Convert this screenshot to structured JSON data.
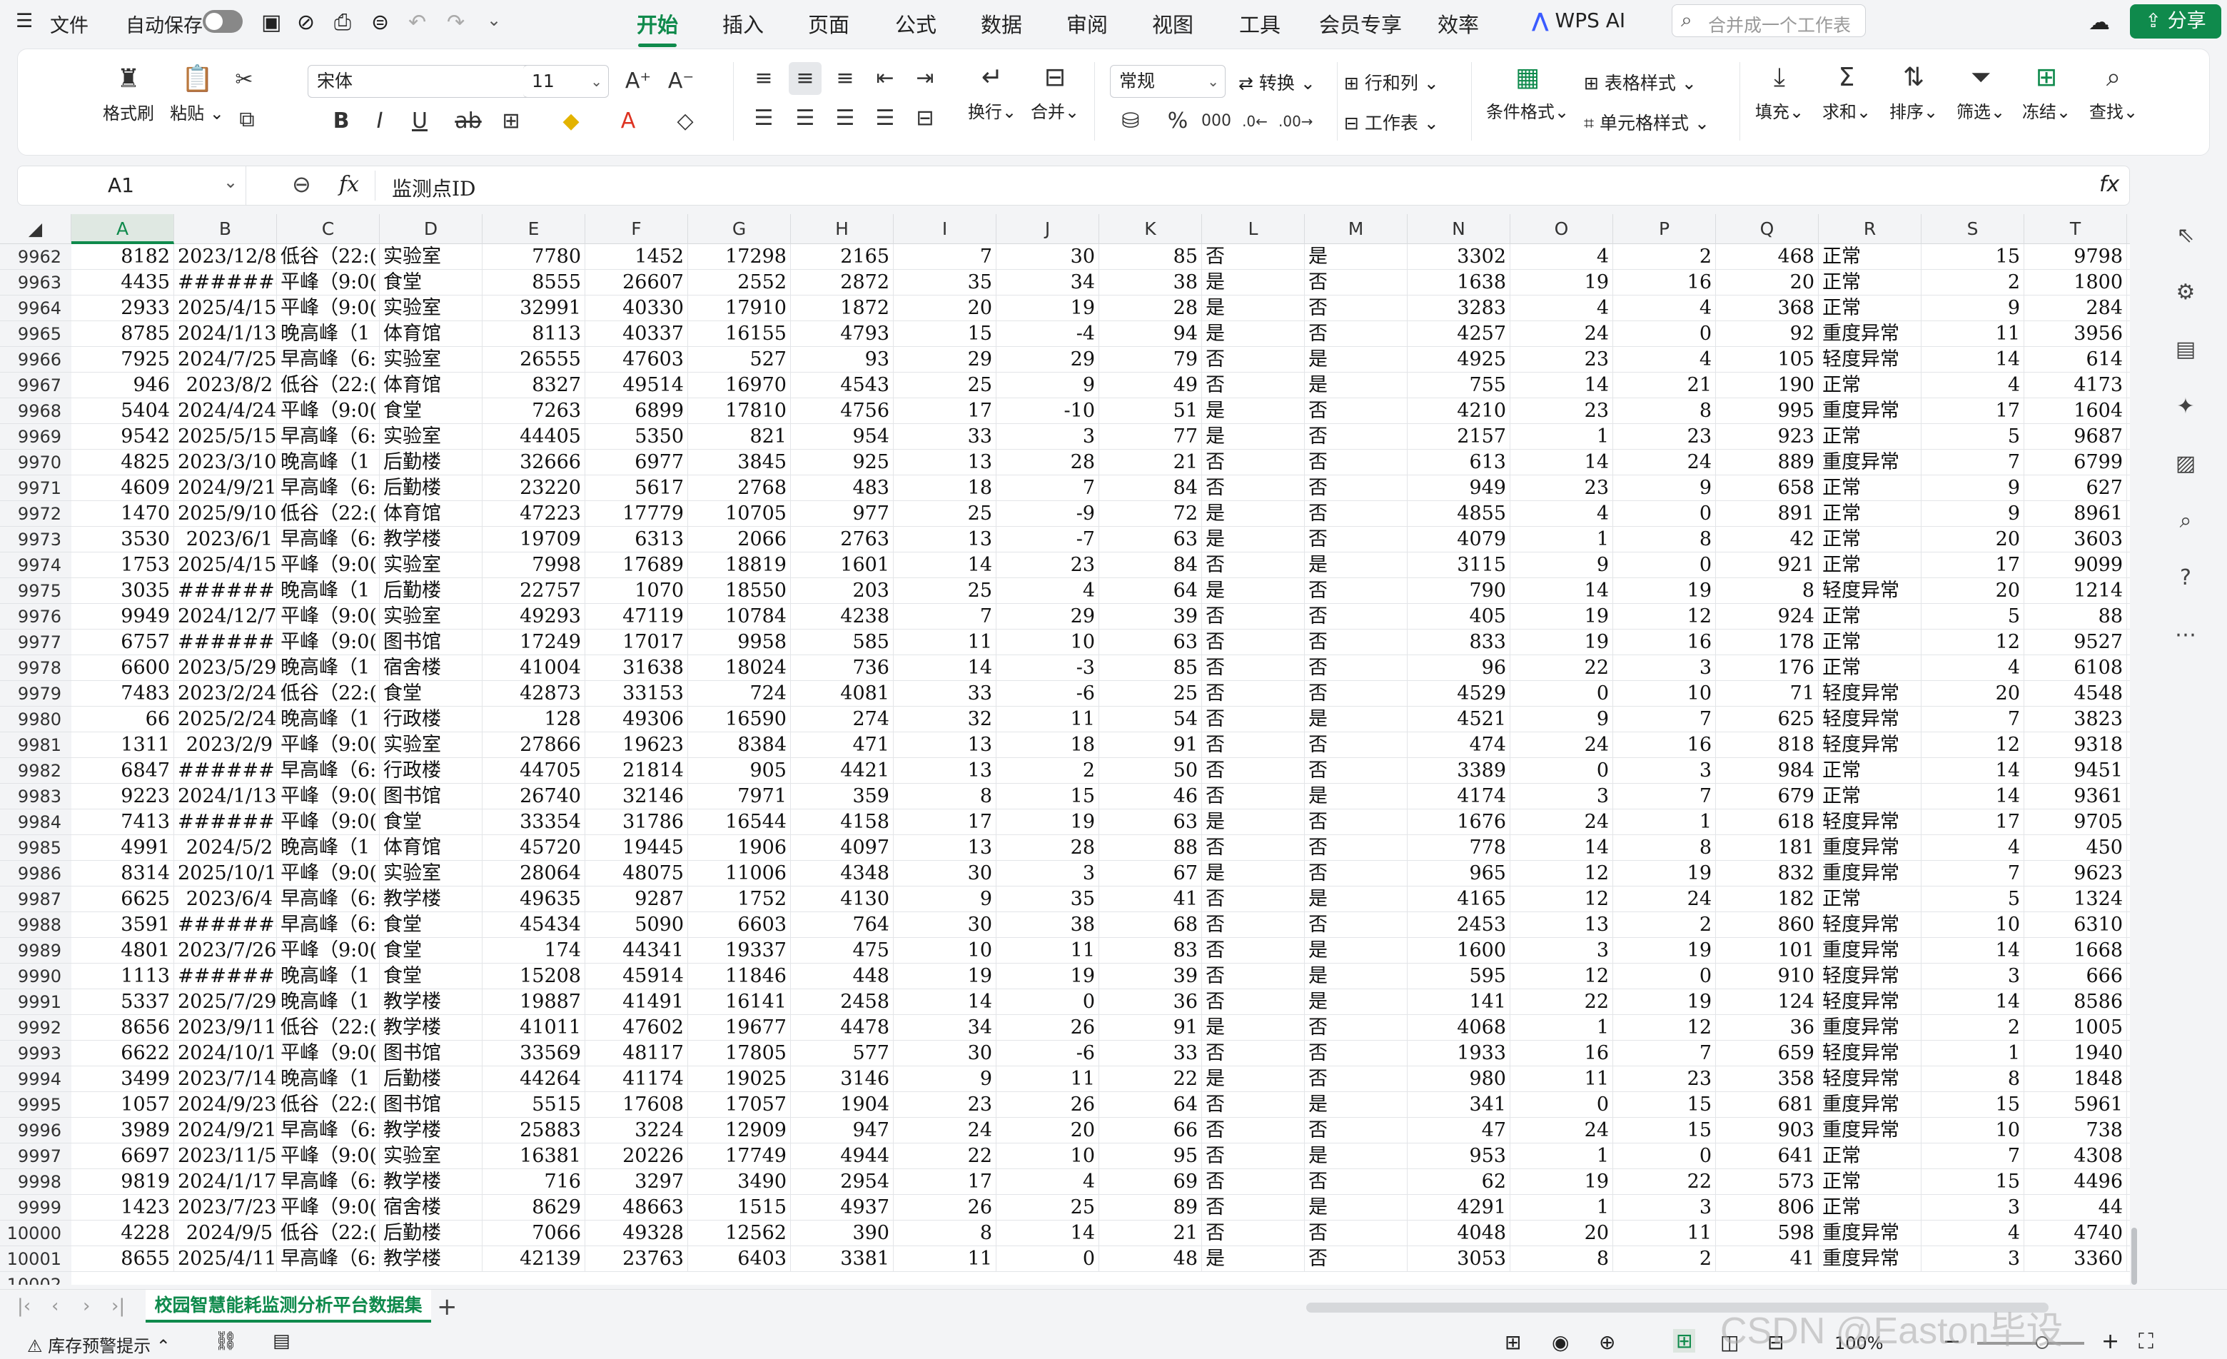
{
  "menubar": {
    "file": "文件",
    "autosave": "自动保存",
    "tabs": [
      "开始",
      "插入",
      "页面",
      "公式",
      "数据",
      "审阅",
      "视图",
      "工具",
      "会员专享",
      "效率"
    ],
    "wps_ai": "WPS AI",
    "search_placeholder": "合并成一个工作表",
    "share": "分享"
  },
  "ribbon": {
    "format_painter": "格式刷",
    "paste": "粘贴",
    "font_name": "宋体",
    "font_size": "11",
    "number_format": "常规",
    "convert": "转换",
    "row_col": "行和列",
    "worksheet": "工作表",
    "wrap": "换行",
    "merge": "合并",
    "cond_format": "条件格式",
    "table_style": "表格样式",
    "cell_style": "单元格样式",
    "fill": "填充",
    "sum": "求和",
    "sort": "排序",
    "filter": "筛选",
    "freeze": "冻结",
    "find": "查找"
  },
  "formula_bar": {
    "cell_ref": "A1",
    "fx": "fx",
    "content": "监测点ID"
  },
  "columns": [
    "A",
    "B",
    "C",
    "D",
    "E",
    "F",
    "G",
    "H",
    "I",
    "J",
    "K",
    "L",
    "M",
    "N",
    "O",
    "P",
    "Q",
    "R",
    "S",
    "T"
  ],
  "rows": [
    {
      "n": "9962",
      "c": [
        "8182",
        "2023/12/8",
        "低谷（22:(",
        "实验室",
        "7780",
        "1452",
        "17298",
        "2165",
        "7",
        "30",
        "85",
        "否",
        "是",
        "3302",
        "4",
        "2",
        "468",
        "正常",
        "15",
        "9798"
      ]
    },
    {
      "n": "9963",
      "c": [
        "4435",
        "########",
        "平峰（9:0(",
        "食堂",
        "8555",
        "26607",
        "2552",
        "2872",
        "35",
        "34",
        "38",
        "是",
        "否",
        "1638",
        "19",
        "16",
        "20",
        "正常",
        "2",
        "1800"
      ]
    },
    {
      "n": "9964",
      "c": [
        "2933",
        "2025/4/15",
        "平峰（9:0(",
        "实验室",
        "32991",
        "40330",
        "17910",
        "1872",
        "20",
        "19",
        "28",
        "是",
        "否",
        "3283",
        "4",
        "4",
        "368",
        "正常",
        "9",
        "284"
      ]
    },
    {
      "n": "9965",
      "c": [
        "8785",
        "2024/1/13",
        "晚高峰（1",
        "体育馆",
        "8113",
        "40337",
        "16155",
        "4793",
        "15",
        "-4",
        "94",
        "是",
        "否",
        "4257",
        "24",
        "0",
        "92",
        "重度异常",
        "11",
        "3956"
      ]
    },
    {
      "n": "9966",
      "c": [
        "7925",
        "2024/7/25",
        "早高峰（6:",
        "实验室",
        "26555",
        "47603",
        "527",
        "93",
        "29",
        "29",
        "79",
        "否",
        "是",
        "4925",
        "23",
        "4",
        "105",
        "轻度异常",
        "14",
        "614"
      ]
    },
    {
      "n": "9967",
      "c": [
        "946",
        "2023/8/2",
        "低谷（22:(",
        "体育馆",
        "8327",
        "49514",
        "16970",
        "4543",
        "25",
        "9",
        "49",
        "否",
        "是",
        "755",
        "14",
        "21",
        "190",
        "正常",
        "4",
        "4173"
      ]
    },
    {
      "n": "9968",
      "c": [
        "5404",
        "2024/4/24",
        "平峰（9:0(",
        "食堂",
        "7263",
        "6899",
        "17810",
        "4756",
        "17",
        "-10",
        "51",
        "是",
        "否",
        "4210",
        "23",
        "8",
        "995",
        "重度异常",
        "17",
        "1604"
      ]
    },
    {
      "n": "9969",
      "c": [
        "9542",
        "2025/5/15",
        "早高峰（6:",
        "实验室",
        "44405",
        "5350",
        "821",
        "954",
        "33",
        "3",
        "77",
        "是",
        "否",
        "2157",
        "1",
        "23",
        "923",
        "正常",
        "5",
        "9687"
      ]
    },
    {
      "n": "9970",
      "c": [
        "4825",
        "2023/3/10",
        "晚高峰（1",
        "后勤楼",
        "32666",
        "6977",
        "3845",
        "925",
        "13",
        "28",
        "21",
        "否",
        "否",
        "613",
        "14",
        "24",
        "889",
        "重度异常",
        "7",
        "6799"
      ]
    },
    {
      "n": "9971",
      "c": [
        "4609",
        "2024/9/21",
        "早高峰（6:",
        "后勤楼",
        "23220",
        "5617",
        "2768",
        "483",
        "18",
        "7",
        "84",
        "否",
        "否",
        "949",
        "23",
        "9",
        "658",
        "正常",
        "9",
        "627"
      ]
    },
    {
      "n": "9972",
      "c": [
        "1470",
        "2025/9/10",
        "低谷（22:(",
        "体育馆",
        "47223",
        "17779",
        "10705",
        "977",
        "25",
        "-9",
        "72",
        "是",
        "否",
        "4855",
        "4",
        "0",
        "891",
        "正常",
        "9",
        "8961"
      ]
    },
    {
      "n": "9973",
      "c": [
        "3530",
        "2023/6/1",
        "早高峰（6:",
        "教学楼",
        "19709",
        "6313",
        "2066",
        "2763",
        "13",
        "-7",
        "63",
        "是",
        "否",
        "4079",
        "1",
        "8",
        "42",
        "正常",
        "20",
        "3603"
      ]
    },
    {
      "n": "9974",
      "c": [
        "1753",
        "2025/4/15",
        "平峰（9:0(",
        "实验室",
        "7998",
        "17689",
        "18819",
        "1601",
        "14",
        "23",
        "84",
        "否",
        "是",
        "3115",
        "9",
        "0",
        "921",
        "正常",
        "17",
        "9099"
      ]
    },
    {
      "n": "9975",
      "c": [
        "3035",
        "########",
        "晚高峰（1",
        "后勤楼",
        "22757",
        "1070",
        "18550",
        "203",
        "25",
        "4",
        "64",
        "是",
        "否",
        "790",
        "14",
        "19",
        "8",
        "轻度异常",
        "20",
        "1214"
      ]
    },
    {
      "n": "9976",
      "c": [
        "9949",
        "2024/12/7",
        "平峰（9:0(",
        "实验室",
        "49293",
        "47119",
        "10784",
        "4238",
        "7",
        "29",
        "39",
        "否",
        "否",
        "405",
        "19",
        "12",
        "924",
        "正常",
        "5",
        "88"
      ]
    },
    {
      "n": "9977",
      "c": [
        "6757",
        "########",
        "平峰（9:0(",
        "图书馆",
        "17249",
        "17017",
        "9958",
        "585",
        "11",
        "10",
        "63",
        "否",
        "否",
        "833",
        "19",
        "16",
        "178",
        "正常",
        "12",
        "9527"
      ]
    },
    {
      "n": "9978",
      "c": [
        "6600",
        "2023/5/29",
        "晚高峰（1",
        "宿舍楼",
        "41004",
        "31638",
        "18024",
        "736",
        "14",
        "-3",
        "85",
        "否",
        "否",
        "96",
        "22",
        "3",
        "176",
        "正常",
        "4",
        "6108"
      ]
    },
    {
      "n": "9979",
      "c": [
        "7483",
        "2023/2/24",
        "低谷（22:(",
        "食堂",
        "42873",
        "33153",
        "724",
        "4081",
        "33",
        "-6",
        "25",
        "否",
        "否",
        "4529",
        "0",
        "10",
        "71",
        "轻度异常",
        "20",
        "4548"
      ]
    },
    {
      "n": "9980",
      "c": [
        "66",
        "2025/2/24",
        "晚高峰（1",
        "行政楼",
        "128",
        "49306",
        "16590",
        "274",
        "32",
        "11",
        "54",
        "否",
        "是",
        "4521",
        "9",
        "7",
        "625",
        "轻度异常",
        "7",
        "3823"
      ]
    },
    {
      "n": "9981",
      "c": [
        "1311",
        "2023/2/9",
        "平峰（9:0(",
        "实验室",
        "27866",
        "19623",
        "8384",
        "471",
        "13",
        "18",
        "91",
        "否",
        "否",
        "474",
        "24",
        "16",
        "818",
        "轻度异常",
        "12",
        "9318"
      ]
    },
    {
      "n": "9982",
      "c": [
        "6847",
        "########",
        "早高峰（6:",
        "行政楼",
        "44705",
        "21814",
        "905",
        "4421",
        "13",
        "2",
        "50",
        "否",
        "否",
        "3389",
        "0",
        "3",
        "984",
        "正常",
        "14",
        "9451"
      ]
    },
    {
      "n": "9983",
      "c": [
        "9223",
        "2024/1/13",
        "平峰（9:0(",
        "图书馆",
        "26740",
        "32146",
        "7971",
        "359",
        "8",
        "15",
        "46",
        "否",
        "是",
        "4174",
        "3",
        "7",
        "679",
        "正常",
        "14",
        "9361"
      ]
    },
    {
      "n": "9984",
      "c": [
        "7413",
        "########",
        "平峰（9:0(",
        "食堂",
        "33354",
        "31786",
        "16544",
        "4158",
        "17",
        "19",
        "63",
        "是",
        "否",
        "1676",
        "24",
        "1",
        "618",
        "轻度异常",
        "17",
        "9705"
      ]
    },
    {
      "n": "9985",
      "c": [
        "4991",
        "2024/5/2",
        "晚高峰（1",
        "体育馆",
        "45720",
        "19445",
        "1906",
        "4097",
        "13",
        "28",
        "88",
        "否",
        "否",
        "778",
        "14",
        "8",
        "181",
        "重度异常",
        "4",
        "450"
      ]
    },
    {
      "n": "9986",
      "c": [
        "8314",
        "2025/10/1",
        "平峰（9:0(",
        "实验室",
        "28064",
        "48075",
        "11006",
        "4348",
        "30",
        "3",
        "67",
        "是",
        "否",
        "965",
        "12",
        "19",
        "832",
        "重度异常",
        "7",
        "9623"
      ]
    },
    {
      "n": "9987",
      "c": [
        "6625",
        "2023/6/4",
        "早高峰（6:",
        "教学楼",
        "49635",
        "9287",
        "1752",
        "4130",
        "9",
        "35",
        "41",
        "否",
        "是",
        "4165",
        "12",
        "24",
        "182",
        "正常",
        "5",
        "1324"
      ]
    },
    {
      "n": "9988",
      "c": [
        "3591",
        "########",
        "早高峰（6:",
        "食堂",
        "45434",
        "5090",
        "6603",
        "764",
        "30",
        "38",
        "68",
        "否",
        "否",
        "2453",
        "13",
        "2",
        "860",
        "轻度异常",
        "10",
        "6310"
      ]
    },
    {
      "n": "9989",
      "c": [
        "4801",
        "2023/7/26",
        "平峰（9:0(",
        "食堂",
        "174",
        "44341",
        "19337",
        "475",
        "10",
        "11",
        "83",
        "否",
        "是",
        "1600",
        "3",
        "19",
        "101",
        "重度异常",
        "14",
        "1668"
      ]
    },
    {
      "n": "9990",
      "c": [
        "1113",
        "########",
        "晚高峰（1",
        "食堂",
        "15208",
        "45914",
        "11846",
        "448",
        "19",
        "19",
        "39",
        "否",
        "是",
        "595",
        "12",
        "0",
        "910",
        "轻度异常",
        "3",
        "666"
      ]
    },
    {
      "n": "9991",
      "c": [
        "5337",
        "2025/7/29",
        "晚高峰（1",
        "教学楼",
        "19887",
        "41491",
        "16141",
        "2458",
        "14",
        "0",
        "36",
        "否",
        "是",
        "141",
        "22",
        "19",
        "124",
        "轻度异常",
        "14",
        "8586"
      ]
    },
    {
      "n": "9992",
      "c": [
        "8656",
        "2023/9/11",
        "低谷（22:(",
        "教学楼",
        "41011",
        "47602",
        "19677",
        "4478",
        "34",
        "26",
        "91",
        "是",
        "否",
        "4068",
        "1",
        "12",
        "36",
        "重度异常",
        "2",
        "1005"
      ]
    },
    {
      "n": "9993",
      "c": [
        "6622",
        "2024/10/1",
        "平峰（9:0(",
        "图书馆",
        "33569",
        "48117",
        "17805",
        "577",
        "30",
        "-6",
        "33",
        "否",
        "否",
        "1933",
        "16",
        "7",
        "659",
        "轻度异常",
        "1",
        "1940"
      ]
    },
    {
      "n": "9994",
      "c": [
        "3499",
        "2023/7/14",
        "晚高峰（1",
        "后勤楼",
        "44264",
        "41174",
        "19025",
        "3146",
        "9",
        "11",
        "22",
        "是",
        "否",
        "980",
        "11",
        "23",
        "358",
        "轻度异常",
        "8",
        "1848"
      ]
    },
    {
      "n": "9995",
      "c": [
        "1057",
        "2024/9/23",
        "低谷（22:(",
        "图书馆",
        "5515",
        "17608",
        "17057",
        "1904",
        "23",
        "26",
        "64",
        "否",
        "是",
        "341",
        "0",
        "15",
        "681",
        "重度异常",
        "15",
        "5961"
      ]
    },
    {
      "n": "9996",
      "c": [
        "3989",
        "2024/9/21",
        "早高峰（6:",
        "教学楼",
        "25883",
        "3224",
        "12909",
        "947",
        "24",
        "20",
        "66",
        "否",
        "否",
        "47",
        "24",
        "15",
        "903",
        "重度异常",
        "10",
        "738"
      ]
    },
    {
      "n": "9997",
      "c": [
        "6697",
        "2023/11/5",
        "平峰（9:0(",
        "实验室",
        "16381",
        "20226",
        "17749",
        "4944",
        "22",
        "10",
        "95",
        "否",
        "是",
        "953",
        "1",
        "0",
        "641",
        "正常",
        "7",
        "4308"
      ]
    },
    {
      "n": "9998",
      "c": [
        "9819",
        "2024/1/17",
        "早高峰（6:",
        "教学楼",
        "716",
        "3297",
        "3490",
        "2954",
        "17",
        "4",
        "69",
        "否",
        "否",
        "62",
        "19",
        "22",
        "573",
        "正常",
        "15",
        "4496"
      ]
    },
    {
      "n": "9999",
      "c": [
        "1423",
        "2023/7/23",
        "平峰（9:0(",
        "宿舍楼",
        "8629",
        "48663",
        "1515",
        "4937",
        "26",
        "25",
        "89",
        "否",
        "是",
        "4291",
        "1",
        "3",
        "806",
        "正常",
        "3",
        "44"
      ]
    },
    {
      "n": "10000",
      "c": [
        "4228",
        "2024/9/5",
        "低谷（22:(",
        "后勤楼",
        "7066",
        "49328",
        "12562",
        "390",
        "8",
        "14",
        "21",
        "否",
        "否",
        "4048",
        "20",
        "11",
        "598",
        "重度异常",
        "4",
        "4740"
      ]
    },
    {
      "n": "10001",
      "c": [
        "8655",
        "2025/4/11",
        "早高峰（6:",
        "教学楼",
        "42139",
        "23763",
        "6403",
        "3381",
        "11",
        "0",
        "48",
        "是",
        "否",
        "3053",
        "8",
        "2",
        "41",
        "重度异常",
        "3",
        "3360"
      ]
    },
    {
      "n": "10002",
      "c": []
    }
  ],
  "sheet_tab": "校园智慧能耗监测分析平台数据集",
  "status": {
    "warning": "库存预警提示",
    "zoom": "100%",
    "watermark": "CSDN @Easton毕设"
  }
}
